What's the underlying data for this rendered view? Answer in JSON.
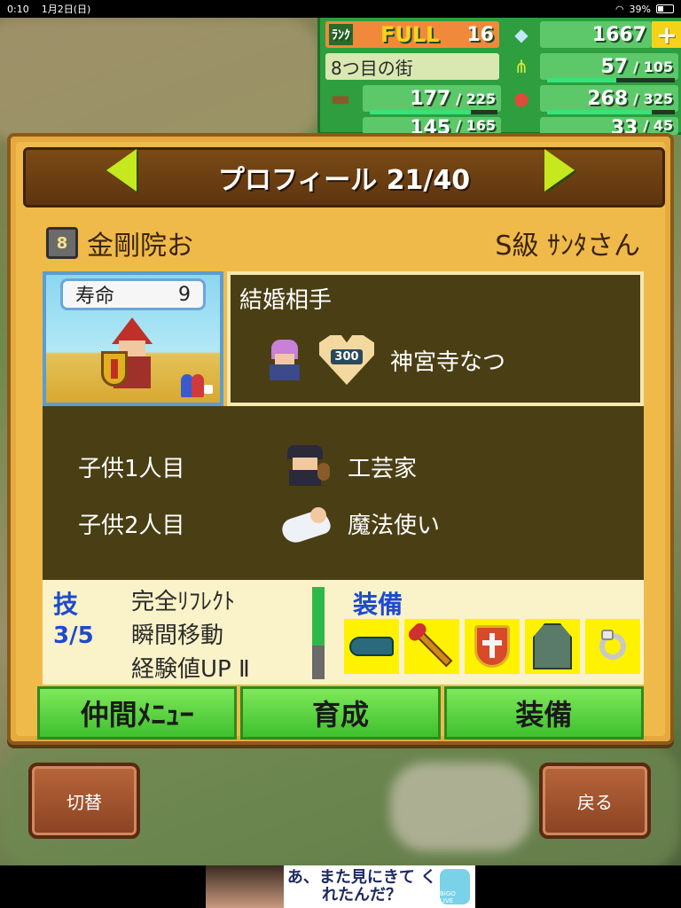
{
  "status_bar": {
    "time": "0:10",
    "date": "1月2日(日)",
    "battery": "39%"
  },
  "resources": {
    "rank_label": "ﾗﾝｸ",
    "rank_status": "FULL",
    "rank_value": "16",
    "gems": "1667",
    "town_name": "8つ目の街",
    "grass": {
      "current": "57",
      "max": "105",
      "fill": 0.54
    },
    "wood": {
      "current": "177",
      "max": "225",
      "fill": 0.79
    },
    "food": {
      "current": "268",
      "max": "325",
      "fill": 0.82
    },
    "row4_left": {
      "current": "145",
      "max": "165"
    },
    "row4_right": {
      "current": "33",
      "max": "45"
    }
  },
  "profile": {
    "title": "プロフィール 21/40",
    "name": "金剛院お",
    "rank_title": "S級 ｻﾝﾀさん",
    "life_label": "寿命",
    "life_value": "9",
    "spouse_label": "結婚相手",
    "spouse_affinity": "300",
    "spouse_name": "神宮寺なつ",
    "children": [
      {
        "label": "子供1人目",
        "job": "工芸家"
      },
      {
        "label": "子供2人目",
        "job": "魔法使い"
      }
    ],
    "skills_label": "技",
    "skills_count": "3/5",
    "skills": [
      "完全ﾘﾌﾚｸﾄ",
      "瞬間移動",
      "経験値UP Ⅱ"
    ],
    "equip_label": "装備",
    "equipment_icons": [
      "boot-icon",
      "staff-icon",
      "shield-icon",
      "armor-icon",
      "ring-icon"
    ]
  },
  "buttons": {
    "party_menu": "仲間ﾒﾆｭｰ",
    "train": "育成",
    "equip": "装備",
    "switch": "切替",
    "back": "戻る"
  },
  "ad": {
    "text": "あ、また見にきて くれたんだ？",
    "logo": "BIGO LIVE"
  },
  "colors": {
    "accent_green": "#3fc02e",
    "panel_brown": "#4a3e14",
    "card_orange": "#f0ba4a",
    "skill_blue": "#1e4ad0"
  }
}
